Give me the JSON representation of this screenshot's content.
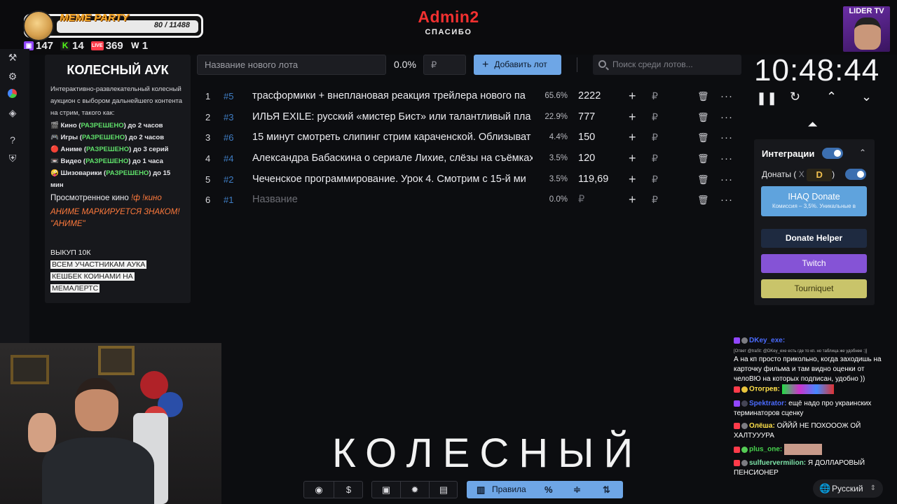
{
  "overlay": {
    "meme_title": "MEME PARTY",
    "meme_count": "80 / 11488",
    "stats": [
      {
        "icon": "twitch-icon",
        "value": "147",
        "color": "#9146ff"
      },
      {
        "icon": "kick-icon",
        "value": "14",
        "color": "#53fc18"
      },
      {
        "icon": "vkplay-live-icon",
        "value": "369",
        "color": "#ff3b4a"
      },
      {
        "icon": "w-icon",
        "value": "1",
        "color": "#ffffff"
      }
    ],
    "admin_title": "Admin2",
    "admin_subtitle": "СПАСИБО",
    "lider_label": "LIDER TV"
  },
  "info": {
    "title": "КОЛЕСНЫЙ АУК",
    "description": "Интерактивно-развлекательный колесный аукцион с выбором дальнейшего контента на стрим, такого как:",
    "items": [
      {
        "name": "Кино",
        "status": "РАЗРЕШЕНО",
        "limit": "до 2 часов"
      },
      {
        "name": "Игры",
        "status": "РАЗРЕШЕНО",
        "limit": "до 2 часов"
      },
      {
        "name": "Аниме",
        "status": "РАЗРЕШЕНО",
        "limit": "до 3 серий"
      },
      {
        "name": "Видео",
        "status": "РАЗРЕШЕНО",
        "limit": "до 1 часа"
      },
      {
        "name": "Шизоварики",
        "status": "РАЗРЕШЕНО",
        "limit": "до 15 мин"
      }
    ],
    "watched_label": "Просмотренное кино",
    "watched_cmd": "!ф !кино",
    "anime_note_1": "АНИМЕ МАРКИРУЕТСЯ ЗНАКОМ!",
    "anime_note_2": "\"АНИМЕ\"",
    "buyout": "ВЫКУП 10К",
    "cashback_1": "ВСЕМ УЧАСТНИКАМ АУКА",
    "cashback_2": "КЕШБЕК КОИНАМИ НА",
    "cashback_3": "МЕМАЛЕРТС"
  },
  "controls": {
    "lot_placeholder": "Название нового лота",
    "percent": "0.0%",
    "currency_placeholder": "₽",
    "add_button": "Добавить лот",
    "search_placeholder": "Поиск среди лотов..."
  },
  "lots": [
    {
      "num": "1",
      "id": "#5",
      "name": "трасформики + внеплановая реакция трейлера нового па",
      "pct": "65.6%",
      "amount": "2222"
    },
    {
      "num": "2",
      "id": "#3",
      "name": "ИЛЬЯ EXILE: русский «мистер Бист» или талантливый пла",
      "pct": "22.9%",
      "amount": "777"
    },
    {
      "num": "3",
      "id": "#6",
      "name": "15 минут смотреть слипинг стрим караченской. Облизыват",
      "pct": "4.4%",
      "amount": "150"
    },
    {
      "num": "4",
      "id": "#4",
      "name": "Александра Бабаскина о сериале Лихие, слёзы на съёмках",
      "pct": "3.5%",
      "amount": "120"
    },
    {
      "num": "5",
      "id": "#2",
      "name": "Чеченское программирование. Урок 4. Смотрим с 15-й ми",
      "pct": "3.5%",
      "amount": "119,69"
    },
    {
      "num": "6",
      "id": "#1",
      "name": "Название",
      "pct": "0.0%",
      "amount": "₽",
      "placeholder": true
    }
  ],
  "lot_actions": {
    "plus": "+",
    "currency": "₽"
  },
  "timer": {
    "value": "10:48:44"
  },
  "integrations": {
    "title": "Интеграции",
    "donations_label": "Донаты (",
    "donations_x": "X",
    "donations_close": ")",
    "dlogo": "D",
    "ihaq_title": "IHAQ Donate",
    "ihaq_sub": "Комиссия – 3,5%. Уникальные в",
    "donate_helper": "Donate Helper",
    "twitch": "Twitch",
    "tourniquet": "Tourniquet"
  },
  "big_word": "КОЛЕСНЫЙ",
  "bottom": {
    "rules": "Правила"
  },
  "language": "Русский",
  "chat": [
    {
      "name": "DKey_exe:",
      "text": "",
      "reply": "[Ответ @traSt: @DKey_exe есть где то кп. но таблица же удобнее :)]"
    },
    {
      "name": "",
      "text": "А на кп просто прикольно, когда заходишь на карточку фильма и там видно оценки от челоВЮ на которых подписан, удобно ))"
    },
    {
      "name": "Отогрев:",
      "text": ""
    },
    {
      "name": "Spektrator:",
      "text": "ещё надо про украинских терминаторов сценку"
    },
    {
      "name": "Олёша:",
      "text": "ОЙЙЙ НЕ ПОХОООЖ   ОЙ ХАЛТУУУРА"
    },
    {
      "name": "plus_one:",
      "text": ""
    },
    {
      "name": "sulfuervermilion:",
      "text": "Я ДОЛЛАРОВЫЙ ПЕНСИОНЕР"
    }
  ]
}
